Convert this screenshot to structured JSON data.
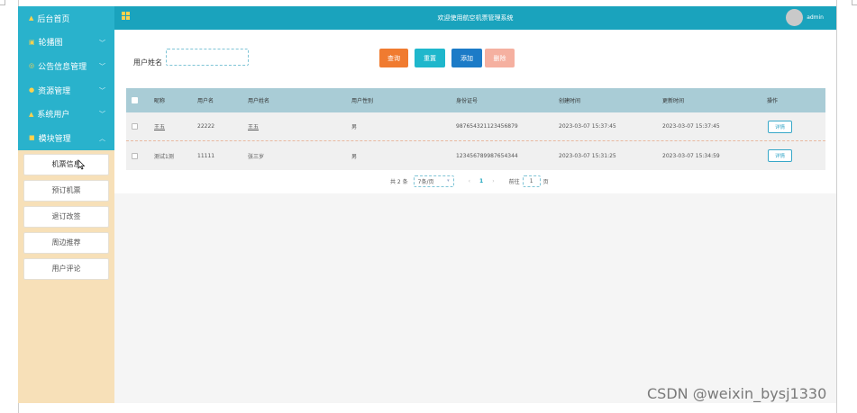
{
  "header": {
    "title": "欢迎使用航空机票管理系统",
    "username": "admin"
  },
  "sidebar": {
    "menu": [
      {
        "label": "后台首页",
        "icon": "home-icon",
        "expandable": false
      },
      {
        "label": "轮播图",
        "icon": "image-icon",
        "expandable": true
      },
      {
        "label": "公告信息管理",
        "icon": "notice-icon",
        "expandable": true
      },
      {
        "label": "资源管理",
        "icon": "resource-icon",
        "expandable": true
      },
      {
        "label": "系统用户",
        "icon": "user-icon",
        "expandable": true
      },
      {
        "label": "模块管理",
        "icon": "module-icon",
        "expandable": true
      }
    ],
    "submenu": [
      {
        "label": "机票信息",
        "active": true
      },
      {
        "label": "预订机票",
        "active": false
      },
      {
        "label": "退订改签",
        "active": false
      },
      {
        "label": "周边推荐",
        "active": false
      },
      {
        "label": "用户评论",
        "active": false
      }
    ]
  },
  "search": {
    "label": "用户姓名",
    "value": "",
    "buttons": {
      "search": "查询",
      "reset": "重置",
      "add": "添加",
      "delete": "删除"
    }
  },
  "table": {
    "columns": [
      "昵称",
      "用户名",
      "用户姓名",
      "用户性别",
      "身份证号",
      "创建时间",
      "更新时间",
      "操作"
    ],
    "rows": [
      {
        "nickname": "王五",
        "username": "22222",
        "realname": "王五",
        "gender": "男",
        "id_number": "987654321123456879",
        "created": "2023-03-07 15:37:45",
        "updated": "2023-03-07 15:37:45",
        "action": "详情"
      },
      {
        "nickname": "测试1测",
        "username": "11111",
        "realname": "张三岁",
        "gender": "男",
        "id_number": "123456789987654344",
        "created": "2023-03-07 15:31:25",
        "updated": "2023-03-07 15:34:59",
        "action": "详情"
      }
    ]
  },
  "pagination": {
    "total": "共 2 条",
    "page_size": "7条/页",
    "current_page": "1",
    "goto_label": "前往",
    "goto_value": "1",
    "page_suffix": "页"
  },
  "watermark": "CSDN @weixin_bysj1330",
  "colors": {
    "header": "#1aa3bd",
    "sidebar_menu": "#29b2cc",
    "sidebar_bg": "#f7e0b8",
    "table_head": "#a9ccd6",
    "btn_search": "#f07b30",
    "btn_reset": "#1fb7cc",
    "btn_add": "#1c7bc7",
    "btn_delete": "#f5b0a0"
  }
}
